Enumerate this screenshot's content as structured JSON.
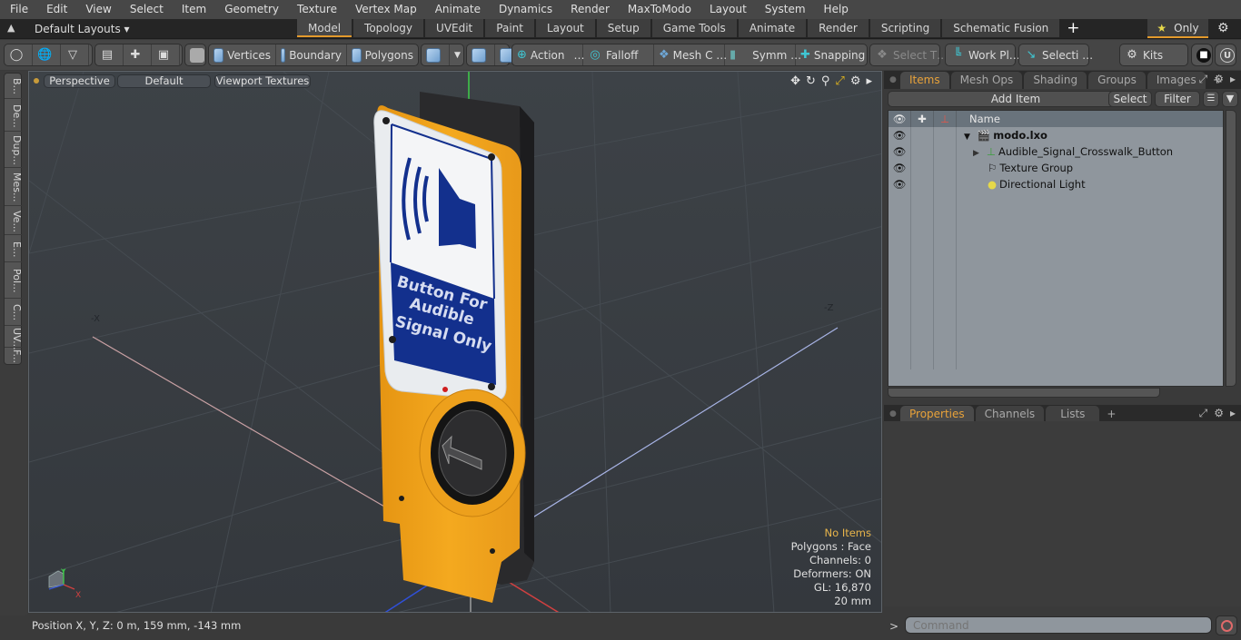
{
  "menu": [
    "File",
    "Edit",
    "View",
    "Select",
    "Item",
    "Geometry",
    "Texture",
    "Vertex Map",
    "Animate",
    "Dynamics",
    "Render",
    "MaxToModo",
    "Layout",
    "System",
    "Help"
  ],
  "layout_bar": {
    "layouts_label": "Default Layouts ▾",
    "tabs": [
      "Model",
      "Topology",
      "UVEdit",
      "Paint",
      "Layout",
      "Setup",
      "Game Tools",
      "Animate",
      "Render",
      "Scripting",
      "Schematic Fusion"
    ],
    "active_tab": "Model",
    "only_label": "Only"
  },
  "toolbar": {
    "vertices": "Vertices",
    "boundary": "Boundary",
    "polygons": "Polygons",
    "action": "Action",
    "action_more": "…",
    "falloff": "Falloff",
    "mesh": "Mesh C …",
    "symmetry": "Symm …",
    "snapping": "Snapping",
    "select_t": "Select T…",
    "work_plane": "Work Pl…",
    "selection": "Selecti …",
    "kits": "Kits"
  },
  "left_tabs": [
    "B...",
    "De...",
    "Dup...",
    "Mes...",
    "Ve...",
    "E...",
    "Pol...",
    "C...",
    "UV...",
    "F..."
  ],
  "viewport": {
    "view_mode": "Perspective",
    "shading": "Default",
    "textures": "Viewport Textures",
    "axis_labels": {
      "neg_x": "-X",
      "neg_z": "-Z"
    },
    "model_sign": {
      "line1": "Button For",
      "line2": "Audible",
      "line3": "Signal Only"
    },
    "info": {
      "selection": "No Items",
      "polygons": "Polygons : Face",
      "channels": "Channels: 0",
      "deformers": "Deformers: ON",
      "gl": "GL: 16,870",
      "scale": "20 mm"
    },
    "gizmo": {
      "y": "Y",
      "x": "X"
    }
  },
  "status": {
    "position": "Position X, Y, Z:   0 m, 159 mm, -143 mm"
  },
  "items_panel": {
    "tabs": [
      "Items",
      "Mesh Ops",
      "Shading",
      "Groups",
      "Images"
    ],
    "active_tab": "Items",
    "add_item": "Add Item",
    "select": "Select",
    "filter": "Filter",
    "column_name": "Name",
    "rows": [
      {
        "name": "modo.lxo",
        "bold": true
      },
      {
        "name": "Audible_Signal_Crosswalk_Button"
      },
      {
        "name": "Texture Group"
      },
      {
        "name": "Directional Light"
      }
    ]
  },
  "props_panel": {
    "tabs": [
      "Properties",
      "Channels",
      "Lists"
    ],
    "active_tab": "Properties"
  },
  "command": {
    "placeholder": "Command",
    "prompt": ">"
  },
  "colors": {
    "accent": "#e39a2c",
    "housing": "#f0a61e",
    "sign_blue": "#0d2f8c"
  }
}
